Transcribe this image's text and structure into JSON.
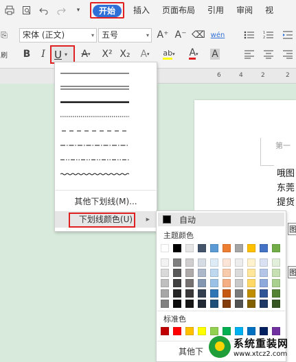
{
  "menubar": {
    "quick_icons": [
      "print-icon",
      "print-preview-icon",
      "undo-icon",
      "redo-icon",
      "dropdown-icon"
    ],
    "tabs": [
      {
        "label": "开始",
        "active": true
      },
      {
        "label": "插入"
      },
      {
        "label": "页面布局"
      },
      {
        "label": "引用"
      },
      {
        "label": "审阅"
      },
      {
        "label": "视"
      }
    ]
  },
  "ribbon": {
    "font_name": "宋体 (正文)",
    "font_size": "五号",
    "row1_icons": {
      "grow_font": "A⁺",
      "shrink_font": "A⁻",
      "clear_format": "⌫",
      "phonetic": "wén"
    },
    "row2_icons": {
      "bold": "B",
      "italic": "I",
      "underline": "U",
      "strikethrough": "A",
      "superscript": "X²",
      "subscript": "X₂",
      "text_effect": "A",
      "highlight": "ab",
      "font_color": "A",
      "char_shading": "A"
    }
  },
  "ruler": {
    "ticks": [
      "6",
      "4",
      "2",
      "2"
    ]
  },
  "document": {
    "heading_partial": "第一",
    "lines": [
      "哦图",
      "东莞",
      "提货"
    ],
    "fragments": [
      "图",
      "图"
    ]
  },
  "underline_menu": {
    "other_underlines": "其他下划线(M)...",
    "underline_color": "下划线颜色(U)"
  },
  "color_flyout": {
    "auto_label": "自动",
    "theme_label": "主题颜色",
    "standard_label": "标准色",
    "more_label": "其他下",
    "theme_top": [
      "#ffffff",
      "#000000",
      "#e7e6e6",
      "#44546a",
      "#5b9bd5",
      "#ed7d31",
      "#a5a5a5",
      "#ffc000",
      "#4472c4",
      "#70ad47"
    ],
    "theme_shades": [
      [
        "#f2f2f2",
        "#7f7f7f",
        "#d0cece",
        "#d6dce4",
        "#ddebf7",
        "#fce4d6",
        "#ededed",
        "#fff2cc",
        "#d9e1f2",
        "#e2efda"
      ],
      [
        "#d9d9d9",
        "#595959",
        "#aeaaaa",
        "#acb9ca",
        "#bdd7ee",
        "#f8cbad",
        "#dbdbdb",
        "#ffe699",
        "#b4c6e7",
        "#c6e0b4"
      ],
      [
        "#bfbfbf",
        "#404040",
        "#757171",
        "#8497b0",
        "#9bc2e6",
        "#f4b084",
        "#c9c9c9",
        "#ffd966",
        "#8ea9db",
        "#a9d08e"
      ],
      [
        "#a6a6a6",
        "#262626",
        "#3a3838",
        "#333f4f",
        "#2f75b5",
        "#c65911",
        "#7b7b7b",
        "#bf8f00",
        "#2f5597",
        "#548235"
      ],
      [
        "#808080",
        "#0d0d0d",
        "#161616",
        "#222b35",
        "#1f4e78",
        "#833c0c",
        "#525252",
        "#806000",
        "#203864",
        "#375623"
      ]
    ],
    "standard_colors": [
      "#c00000",
      "#ff0000",
      "#ffc000",
      "#ffff00",
      "#92d050",
      "#00b050",
      "#00b0f0",
      "#0070c0",
      "#002060",
      "#7030a0"
    ]
  },
  "watermark": {
    "title": "系统重装网",
    "url": "www.xtcz2.com"
  }
}
